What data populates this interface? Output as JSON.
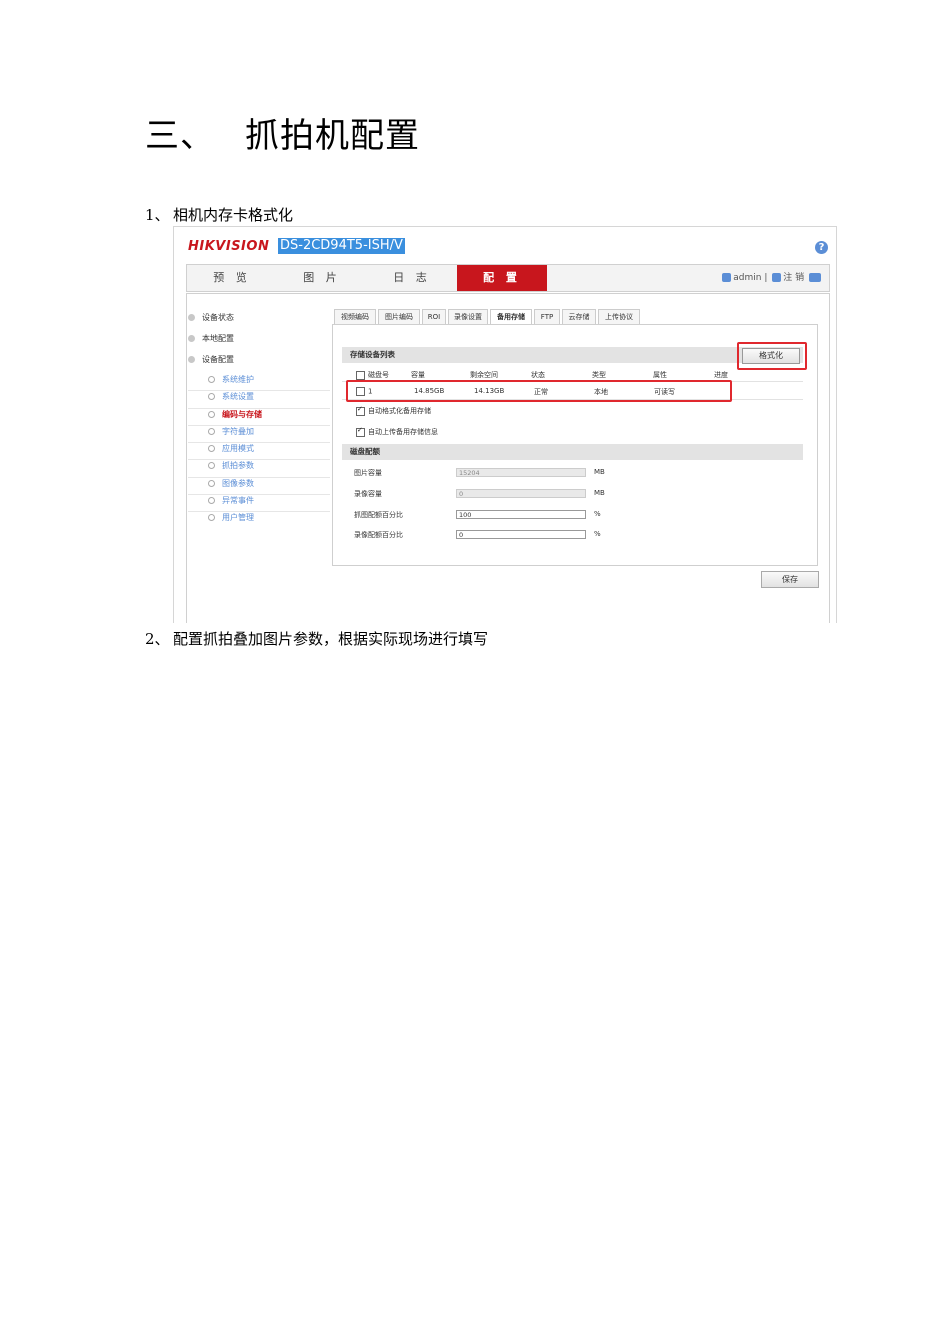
{
  "heading": {
    "number": "三、",
    "title": "抓拍机配置"
  },
  "steps": [
    {
      "index": "1、",
      "text": "相机内存卡格式化"
    },
    {
      "index": "2、",
      "text": "配置抓拍叠加图片参数，根据实际现场进行填写"
    }
  ],
  "app": {
    "logo": "HIKVISION",
    "model": "DS-2CD94T5-ISH/V",
    "help_icon": "?",
    "nav": [
      "预 览",
      "图 片",
      "日 志",
      "配 置"
    ],
    "user": {
      "name": "admin",
      "separator": "|",
      "logout": "注 销"
    }
  },
  "sidebar": {
    "top": [
      "设备状态",
      "本地配置",
      "设备配置"
    ],
    "sub": [
      "系统维护",
      "系统设置",
      "编码与存储",
      "字符叠加",
      "应用模式",
      "抓拍参数",
      "图像参数",
      "异常事件",
      "用户管理"
    ]
  },
  "tabs": [
    "视频编码",
    "图片编码",
    "ROI",
    "录像设置",
    "备用存储",
    "FTP",
    "云存储",
    "上传协议"
  ],
  "storage": {
    "section_title": "存储设备列表",
    "format_button": "格式化",
    "columns": [
      "磁盘号",
      "容量",
      "剩余空间",
      "状态",
      "类型",
      "属性",
      "进度"
    ],
    "row": [
      "1",
      "14.85GB",
      "14.13GB",
      "正常",
      "本地",
      "可读写",
      ""
    ],
    "options": [
      "自动格式化备用存储",
      "自动上传备用存储信息"
    ]
  },
  "quota": {
    "section_title": "磁盘配额",
    "fields": [
      {
        "label": "图片容量",
        "value": "15204",
        "unit": "MB"
      },
      {
        "label": "录像容量",
        "value": "0",
        "unit": "MB"
      },
      {
        "label": "抓图配额百分比",
        "value": "100",
        "unit": "%"
      },
      {
        "label": "录像配额百分比",
        "value": "0",
        "unit": "%"
      }
    ]
  },
  "save_button": "保存",
  "colors": {
    "brand_red": "#c8161d",
    "highlight_red": "#e0282e",
    "link_blue": "#5b8ed6"
  }
}
